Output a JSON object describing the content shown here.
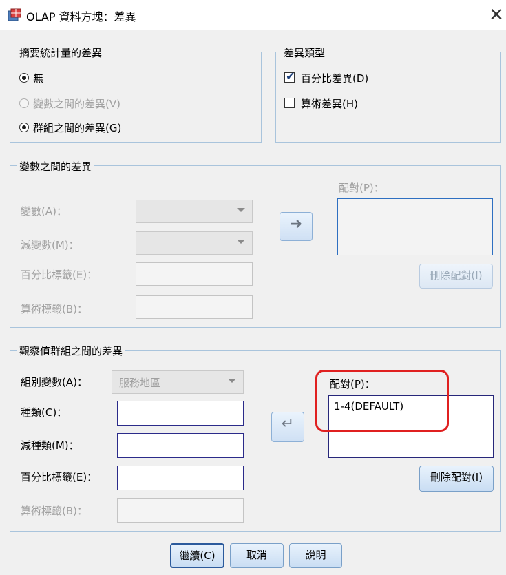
{
  "window": {
    "title": "OLAP 資料方塊：差異",
    "close_glyph": "✕"
  },
  "summary_group": {
    "legend": "摘要統計量的差異",
    "options": [
      {
        "label": "無",
        "selected": true,
        "enabled": true
      },
      {
        "label": "變數之間的差異(V)",
        "selected": false,
        "enabled": false
      },
      {
        "label": "群組之間的差異(G)",
        "selected": true,
        "enabled": true
      }
    ]
  },
  "diff_type_group": {
    "legend": "差異類型",
    "options": [
      {
        "label": "百分比差異(D)",
        "checked": true
      },
      {
        "label": "算術差異(H)",
        "checked": false
      }
    ]
  },
  "variables_group": {
    "legend": "變數之間的差異",
    "variable_label": "變數(A)：",
    "minus_variable_label": "減變數(M)：",
    "percent_label_label": "百分比標籤(E)：",
    "arith_label_label": "算術標籤(B)：",
    "pairs_label": "配對(P)：",
    "delete_pair_label": "刪除配對(I)",
    "arrow_icon": "arrow-right-icon"
  },
  "cases_group": {
    "legend": "觀察值群組之間的差異",
    "grouping_label": "組別變數(A)：",
    "grouping_value": "服務地區",
    "category_label": "種類(C)：",
    "category_value": "",
    "minus_category_label": "減種類(M)：",
    "minus_category_value": "",
    "percent_label_label": "百分比標籤(E)：",
    "percent_label_value": "",
    "arith_label_label": "算術標籤(B)：",
    "pairs_label": "配對(P)：",
    "pairs": [
      "1-4(DEFAULT)"
    ],
    "delete_pair_label": "刪除配對(I)",
    "arrow_icon": "arrow-left-return-icon"
  },
  "buttons": {
    "continue": "繼續(C)",
    "cancel": "取消",
    "help": "說明"
  },
  "colors": {
    "highlight": "#e02020",
    "group_border": "#a9c4dc",
    "field_border": "#2b2b8a"
  }
}
